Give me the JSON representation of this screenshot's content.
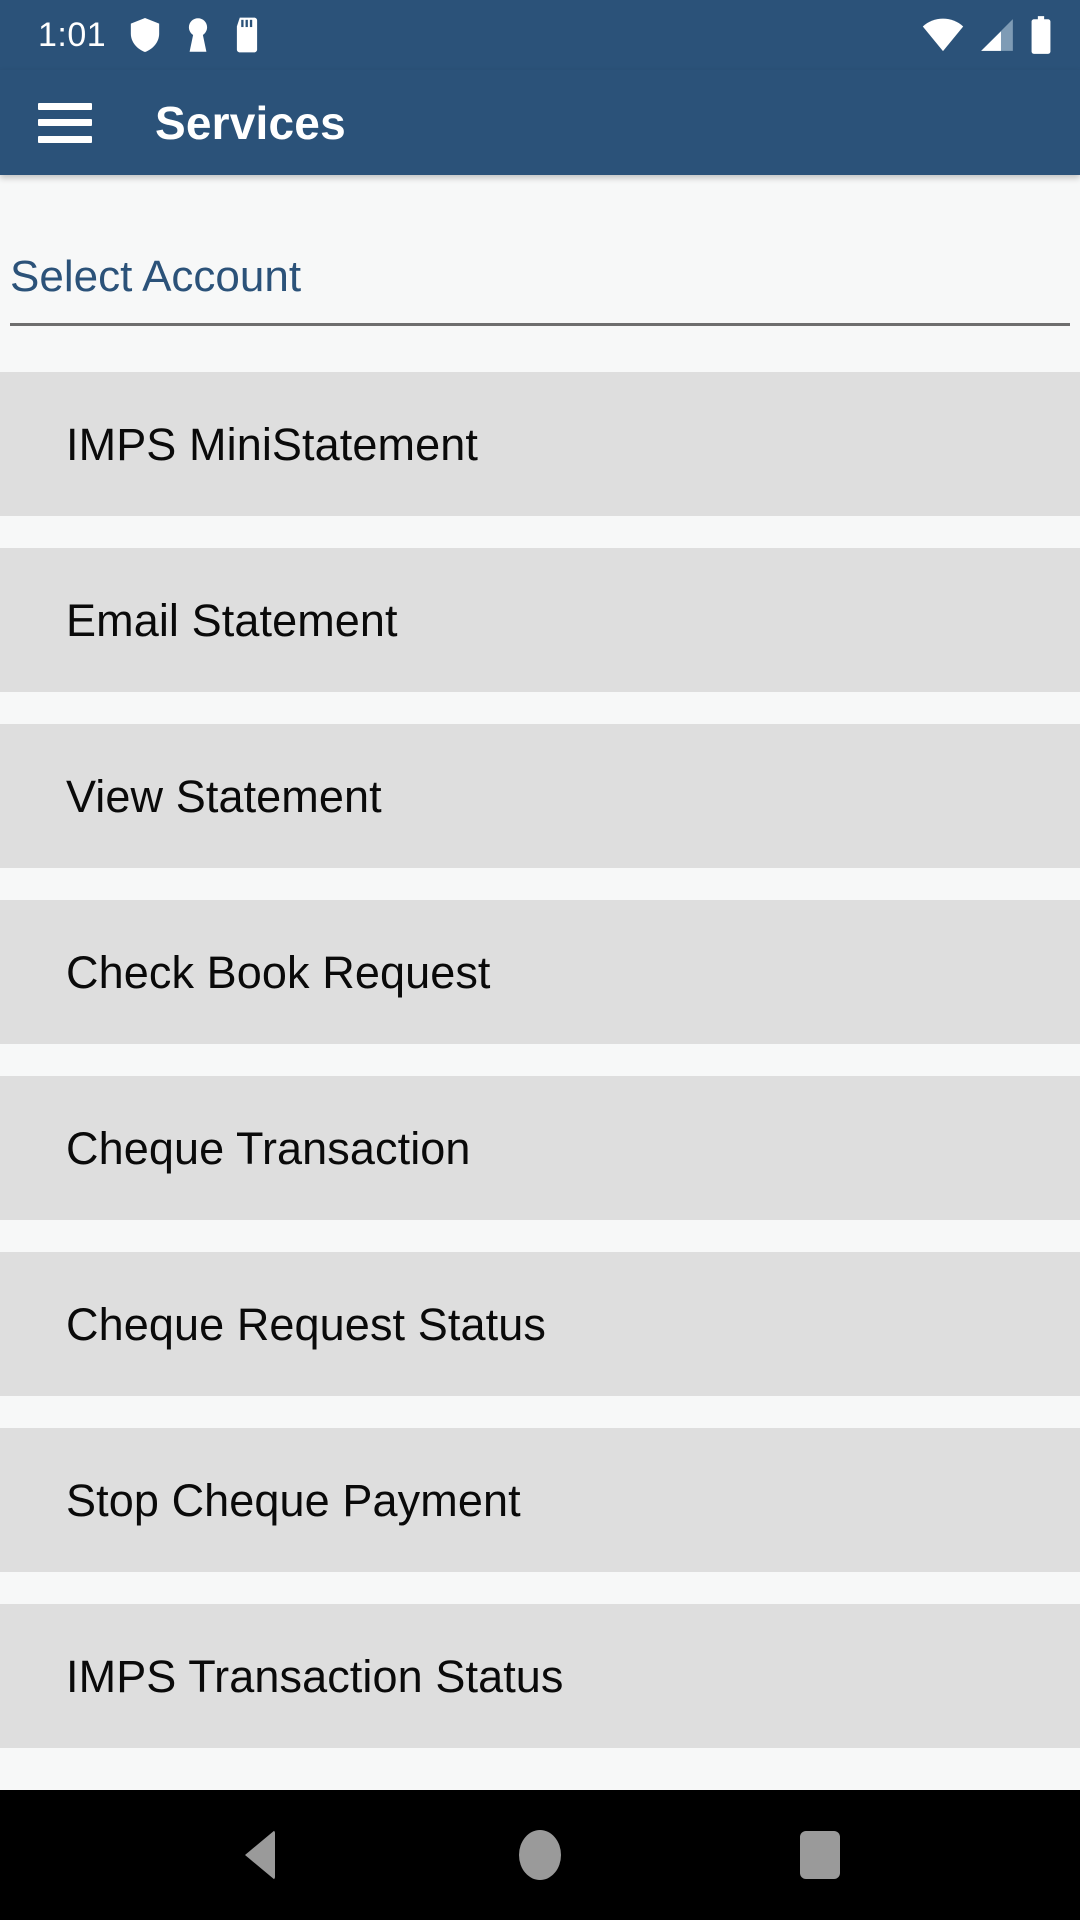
{
  "status_bar": {
    "time": "1:01",
    "left_icons": [
      "shield-icon",
      "vpn-key-icon",
      "sd-card-icon"
    ],
    "right_icons": [
      "wifi-icon",
      "cellular-signal-icon",
      "battery-icon"
    ],
    "background_color": "#2b5279",
    "foreground_color": "#ffffff"
  },
  "app_bar": {
    "menu_icon": "hamburger-menu-icon",
    "title": "Services",
    "background_color": "#2b5279",
    "title_color": "#ffffff"
  },
  "account_spinner": {
    "label": "Select Account",
    "label_color": "#2b5279",
    "underline_color": "#6e6e6e"
  },
  "services": {
    "row_background": "#dedede",
    "row_text_color": "#0a0a0a",
    "items": [
      {
        "label": "IMPS MiniStatement"
      },
      {
        "label": "Email Statement"
      },
      {
        "label": "View Statement"
      },
      {
        "label": "Check Book Request"
      },
      {
        "label": "Cheque Transaction"
      },
      {
        "label": "Cheque Request Status"
      },
      {
        "label": "Stop Cheque Payment"
      },
      {
        "label": "IMPS Transaction Status"
      }
    ]
  },
  "nav_bar": {
    "background_color": "#000000",
    "icon_color": "#9a9a9a",
    "buttons": [
      {
        "name": "back-button"
      },
      {
        "name": "home-button"
      },
      {
        "name": "recents-button"
      }
    ]
  }
}
